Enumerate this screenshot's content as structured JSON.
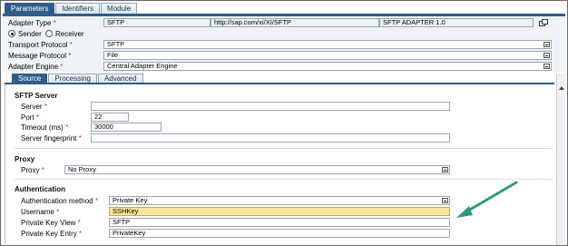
{
  "tabs": [
    "Parameters",
    "Identifiers",
    "Module"
  ],
  "header": {
    "adapter_type_label": "Adapter Type",
    "adapter_type_value": "SFTP",
    "namespace_value": "http://sap.com/xi/XI/SFTP",
    "version_value": "SFTP ADAPTER 1.0",
    "sender_label": "Sender",
    "receiver_label": "Receiver",
    "transport_protocol_label": "Transport Protocol",
    "transport_protocol_value": "SFTP",
    "message_protocol_label": "Message Protocol",
    "message_protocol_value": "File",
    "adapter_engine_label": "Adapter Engine",
    "adapter_engine_value": "Central Adapter Engine",
    "required_mark": "*"
  },
  "subtabs": [
    "Source",
    "Processing",
    "Advanced"
  ],
  "sftp_server": {
    "title": "SFTP Server",
    "server_label": "Server",
    "server_value": "",
    "port_label": "Port",
    "port_value": "22",
    "timeout_label": "Timeout (ms)",
    "timeout_value": "30000",
    "fingerprint_label": "Server fingerprint",
    "fingerprint_value": ""
  },
  "proxy": {
    "title": "Proxy",
    "proxy_label": "Proxy",
    "proxy_value": "No Proxy"
  },
  "authentication": {
    "title": "Authentication",
    "method_label": "Authentication method",
    "method_value": "Private Key",
    "username_label": "Username",
    "username_value": "SSHKey",
    "pk_view_label": "Private Key View",
    "pk_view_value": "SFTP",
    "pk_entry_label": "Private Key Entry",
    "pk_entry_value": "PrivateKey"
  },
  "colors": {
    "tab_active": "#2f5d8a",
    "highlight_field": "#fbe59a",
    "arrow": "#2e9a7c",
    "required": "#c0392b"
  },
  "icons": [
    "copy-icon",
    "dropdown-icon",
    "scroll-up-icon",
    "annotation-arrow-icon"
  ]
}
